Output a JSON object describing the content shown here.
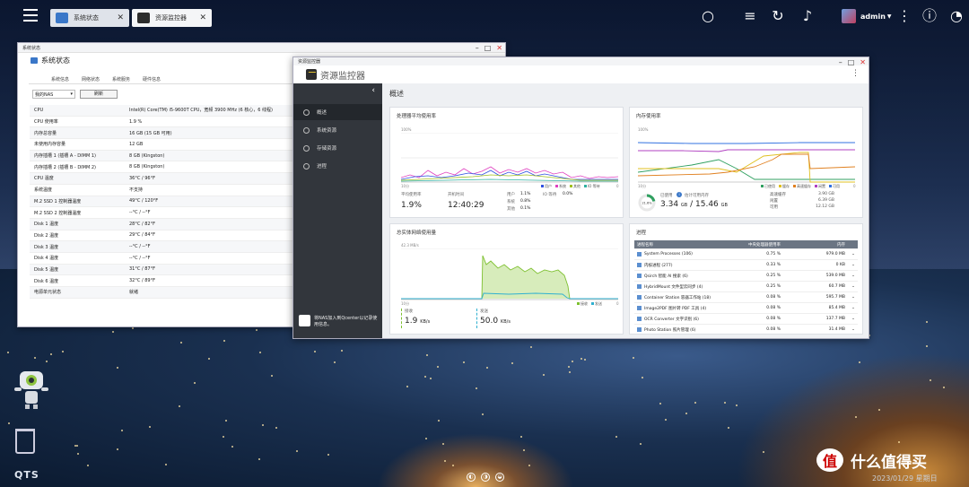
{
  "taskbar": {
    "tabs": [
      {
        "label": "系统状态",
        "active": false
      },
      {
        "label": "资源监控器",
        "active": true
      }
    ],
    "user": "admin",
    "icons": [
      "search-icon",
      "tasks-icon",
      "sync-icon",
      "bell-icon",
      "more-icon",
      "info-icon",
      "dashboard-icon"
    ]
  },
  "system_status": {
    "window_title": "系统状态",
    "header": "系统状态",
    "tabs": [
      "系统信息",
      "网络状态",
      "系统服务",
      "硬件信息"
    ],
    "active_tab": "硬件信息",
    "select_value": "我的NAS",
    "refresh_label": "刷新",
    "rows": [
      {
        "k": "CPU",
        "v": "Intel(R) Core(TM) i5-9600T CPU，宽频 3900 MHz (6 核心，6 线程)"
      },
      {
        "k": "CPU 使用率",
        "v": "1.9 %"
      },
      {
        "k": "内存总容量",
        "v": "16 GB (15 GB 可用)"
      },
      {
        "k": "未使用内存容量",
        "v": "12 GB"
      },
      {
        "k": "内存插槽 1 (插槽 A - DIMM 1)",
        "v": "8 GB (Kingston)"
      },
      {
        "k": "内存插槽 2 (插槽 B - DIMM 2)",
        "v": "8 GB (Kingston)"
      },
      {
        "k": "CPU 温度",
        "v": "36°C / 96°F"
      },
      {
        "k": "系统温度",
        "v": "不支持"
      },
      {
        "k": "M.2 SSD 1 控制器温度",
        "v": "49°C / 120°F"
      },
      {
        "k": "M.2 SSD 2 控制器温度",
        "v": "--°C / --°F"
      },
      {
        "k": "Disk 1 温度",
        "v": "28°C / 82°F"
      },
      {
        "k": "Disk 2 温度",
        "v": "29°C / 84°F"
      },
      {
        "k": "Disk 3 温度",
        "v": "--°C / --°F"
      },
      {
        "k": "Disk 4 温度",
        "v": "--°C / --°F"
      },
      {
        "k": "Disk 5 温度",
        "v": "31°C / 87°F"
      },
      {
        "k": "Disk 6 温度",
        "v": "32°C / 89°F"
      },
      {
        "k": "电源单元状态",
        "v": "就绪"
      }
    ]
  },
  "resource_monitor": {
    "window_title": "资源监控器",
    "title": "资源监控器",
    "page_title": "概述",
    "nav": [
      {
        "label": "概述",
        "active": true
      },
      {
        "label": "系统资源",
        "active": false
      },
      {
        "label": "存储资源",
        "active": false
      },
      {
        "label": "进程",
        "active": false
      }
    ],
    "promo": "将NAS加入到Qcenter以记录使用信息。",
    "cpu": {
      "title": "处理器平均使用率",
      "y_top": "100%",
      "x_left": "10分",
      "x_right": "0",
      "legend": [
        "用户",
        "系统",
        "其他",
        "IO 等待"
      ],
      "avg_label": "平均使用率",
      "avg_value": "1.9%",
      "uptime_label": "开机时间",
      "uptime_value": "12:40:29",
      "user_label": "用户",
      "user_value": "1.1%",
      "sys_label": "系统",
      "sys_value": "0.8%",
      "other_label": "其他",
      "other_value": "0.1%",
      "io_label": "IO 等待",
      "io_value": "0.0%"
    },
    "memory": {
      "title": "内存使用率",
      "y_top": "100%",
      "x_left": "10分",
      "x_right": "0",
      "legend": [
        "已使用",
        "缓存",
        "高速缓存",
        "闲置",
        "可用"
      ],
      "percent": "21.6%",
      "used_label": "已使用",
      "info_label": "估计可用内存",
      "value": "3.34",
      "unit": "GB",
      "total": "/ 15.46",
      "total_unit": "GB",
      "rows": [
        {
          "k": "高速缓存",
          "v": "3.90 GB"
        },
        {
          "k": "闲置",
          "v": "6.39 GB"
        },
        {
          "k": "可用",
          "v": "12.12 GB"
        }
      ]
    },
    "network": {
      "title": "总实体网络使用量",
      "y_top": "42.3 MB/s",
      "x_left": "10分",
      "x_right": "0",
      "legend": [
        "接收",
        "发送"
      ],
      "rx_label": "接收",
      "rx_value": "1.9",
      "rx_unit": "KB/s",
      "tx_label": "发送",
      "tx_value": "50.0",
      "tx_unit": "KB/s"
    },
    "process": {
      "title": "进程",
      "headers": [
        "进程名称",
        "中央处理器使用率",
        "内存"
      ],
      "rows": [
        {
          "name": "System Processes (106)",
          "cpu": "0.75 %",
          "mem": "979.0 MB"
        },
        {
          "name": "内核进程 (277)",
          "cpu": "0.33 %",
          "mem": "0 KB"
        },
        {
          "name": "Qsirch 智能 AI 搜索 (6)",
          "cpu": "0.25 %",
          "mem": "539.0 MB"
        },
        {
          "name": "HybridMount 文件型云同步 (4)",
          "cpu": "0.25 %",
          "mem": "60.7 MB"
        },
        {
          "name": "Container Station 容器工作站 (18)",
          "cpu": "0.08 %",
          "mem": "595.7 MB"
        },
        {
          "name": "Image2PDF 图片转 PDF 工具 (4)",
          "cpu": "0.08 %",
          "mem": "85.4 MB"
        },
        {
          "name": "OCR Converter 文字识别 (6)",
          "cpu": "0.08 %",
          "mem": "137.7 MB"
        },
        {
          "name": "Photo Station 照片管理 (6)",
          "cpu": "0.08 %",
          "mem": "31.4 MB"
        }
      ]
    }
  },
  "desktop": {
    "qts": "QTS",
    "watermark": "什么值得买",
    "date": "2023/01/29 星期日"
  }
}
